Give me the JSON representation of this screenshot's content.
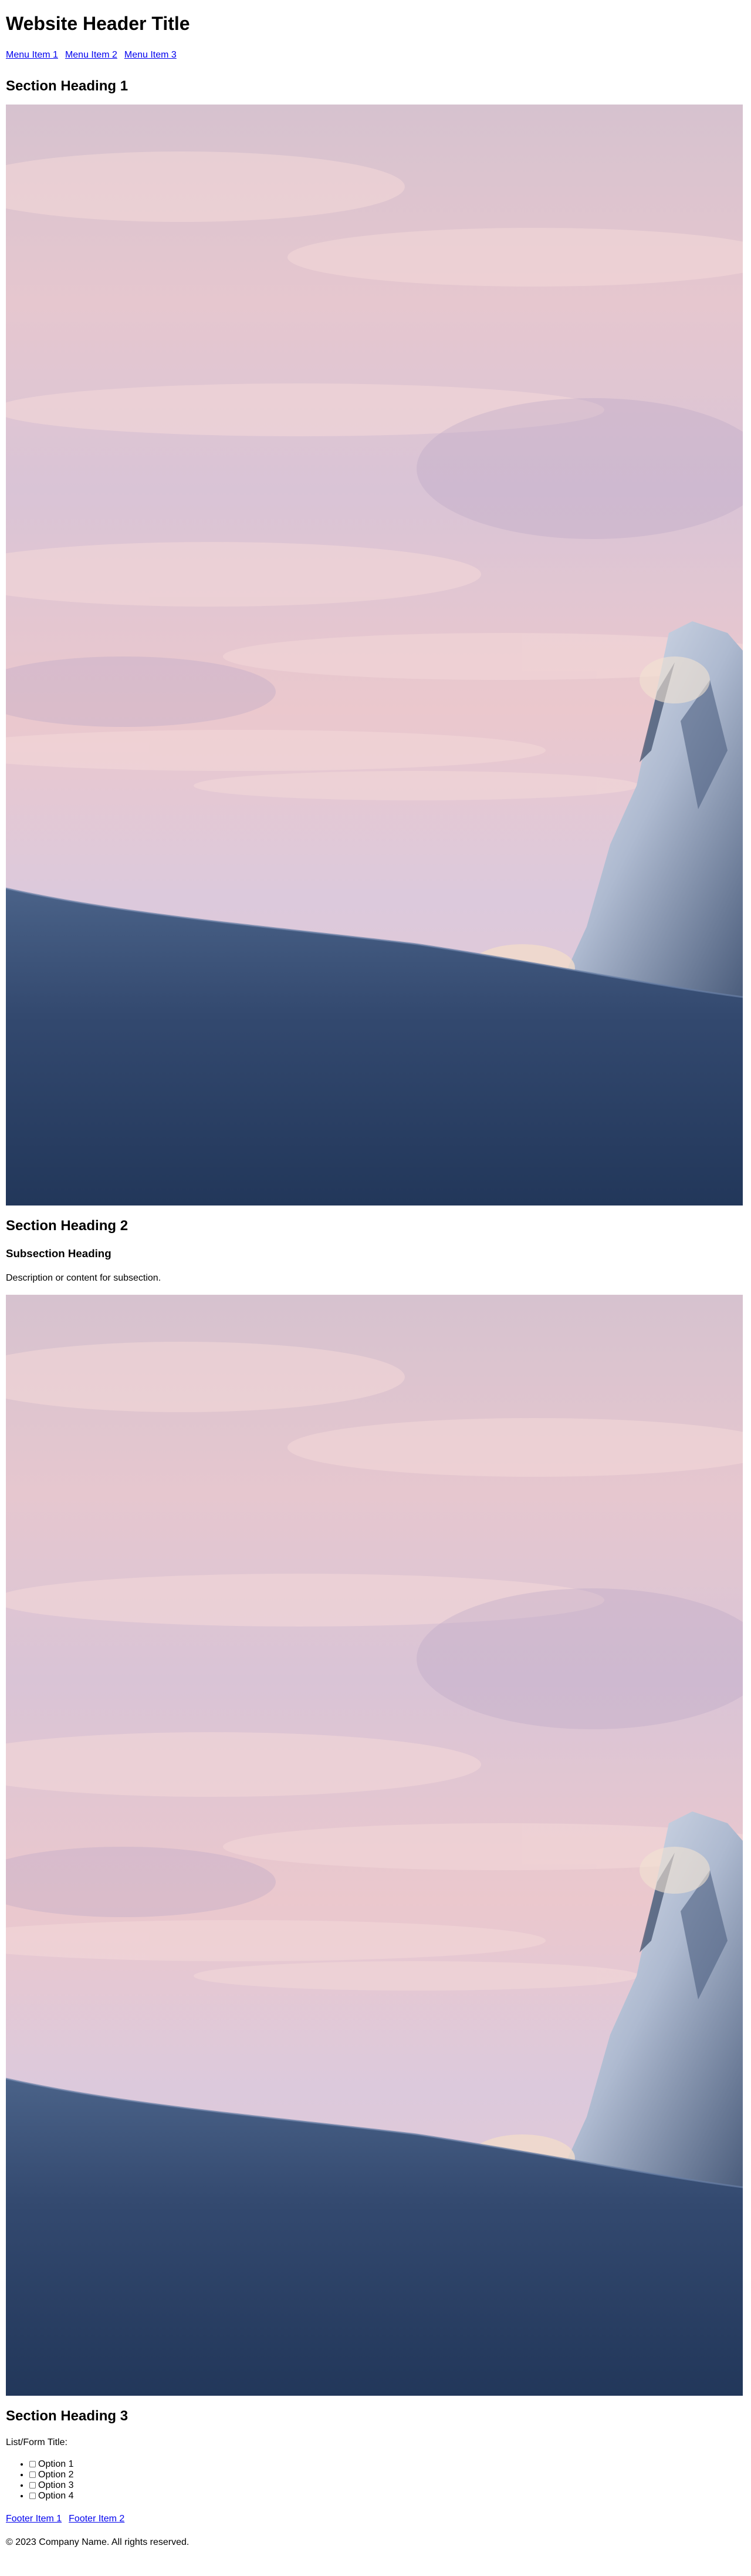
{
  "header": {
    "title": "Website Header Title",
    "menu": [
      "Menu Item 1",
      "Menu Item 2",
      "Menu Item 3"
    ]
  },
  "section1": {
    "heading": "Section Heading 1",
    "image": "mountain-sunset-image"
  },
  "section2": {
    "heading": "Section Heading 2",
    "subheading": "Subsection Heading",
    "description": "Description or content for subsection.",
    "image": "mountain-sunset-image"
  },
  "section3": {
    "heading": "Section Heading 3",
    "form_title": "List/Form Title:",
    "options": [
      "Option 1",
      "Option 2",
      "Option 3",
      "Option 4"
    ]
  },
  "footer": {
    "links": [
      "Footer Item 1",
      "Footer Item 2"
    ],
    "copyright": "© 2023 Company Name. All rights reserved."
  },
  "colors": {
    "link": "#0000ee",
    "sky_top": "#cdbdd0",
    "sky_pink": "#e8c2c6",
    "snow_ground": "#2c4468"
  }
}
